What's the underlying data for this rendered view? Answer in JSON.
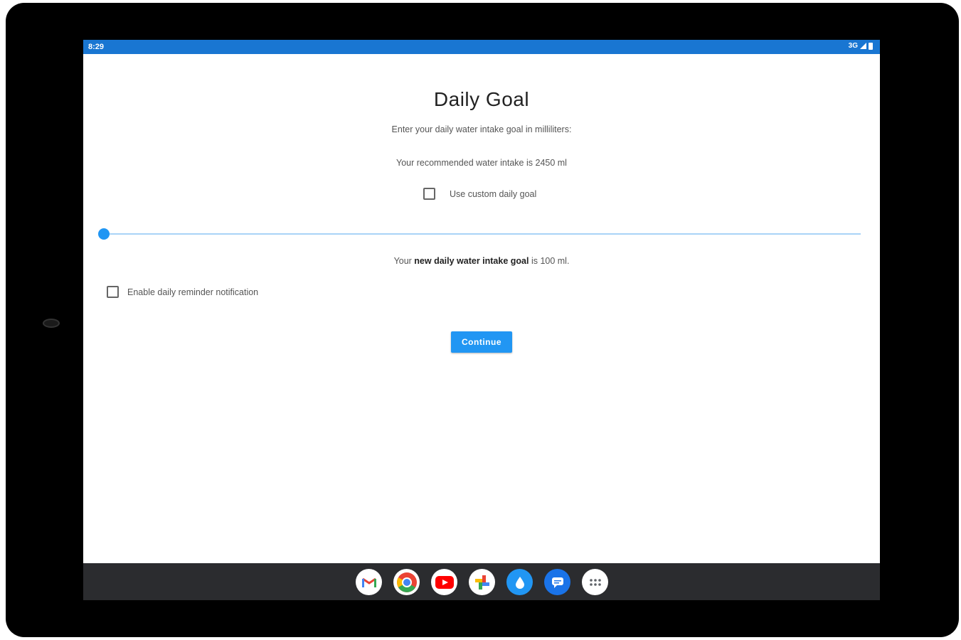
{
  "status_bar": {
    "time": "8:29",
    "network": "3G"
  },
  "page": {
    "title": "Daily Goal",
    "instruction": "Enter your daily water intake goal in milliliters:",
    "recommendation": "Your recommended water intake is 2450 ml",
    "custom_goal_label": "Use custom daily goal",
    "custom_goal_checked": false,
    "slider_value_fraction": 0.0,
    "goal_prefix": "Your ",
    "goal_bold": "new daily water intake goal",
    "goal_suffix": " is 100 ml.",
    "reminder_label": "Enable daily reminder notification",
    "reminder_checked": false,
    "continue_label": "Continue"
  },
  "dock": {
    "apps": [
      "gmail-icon",
      "chrome-icon",
      "youtube-icon",
      "photos-icon",
      "water-app-icon",
      "messages-icon",
      "app-drawer-icon"
    ]
  },
  "colors": {
    "status_bar": "#1976d2",
    "accent": "#2196f3",
    "dock": "#2b2c2f"
  }
}
